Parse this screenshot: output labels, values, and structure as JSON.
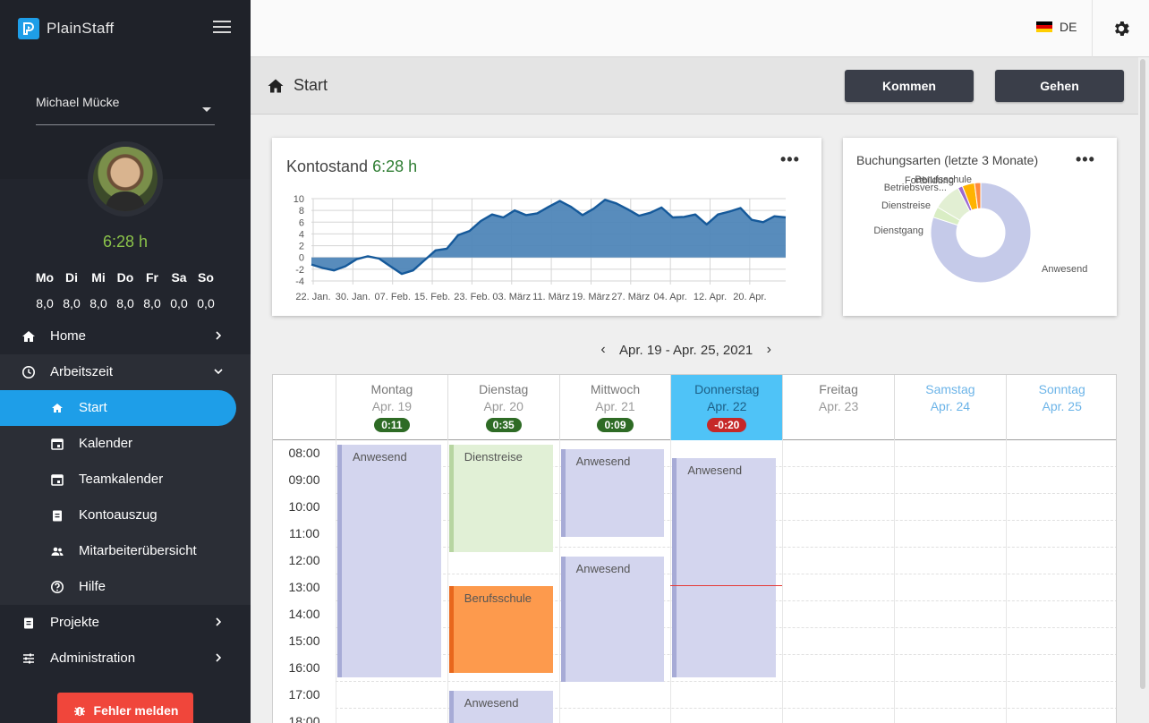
{
  "app": {
    "name": "PlainStaff"
  },
  "sidebar": {
    "user": "Michael Mücke",
    "balance": "6:28 h",
    "week": [
      {
        "day": "Mo",
        "hours": "8,0"
      },
      {
        "day": "Di",
        "hours": "8,0"
      },
      {
        "day": "Mi",
        "hours": "8,0"
      },
      {
        "day": "Do",
        "hours": "8,0"
      },
      {
        "day": "Fr",
        "hours": "8,0"
      },
      {
        "day": "Sa",
        "hours": "0,0"
      },
      {
        "day": "So",
        "hours": "0,0"
      }
    ],
    "nav": {
      "home": "Home",
      "arbeitszeit": "Arbeitszeit",
      "start": "Start",
      "kalender": "Kalender",
      "teamkalender": "Teamkalender",
      "kontoauszug": "Kontoauszug",
      "mitarbeiter": "Mitarbeiterübersicht",
      "hilfe": "Hilfe",
      "projekte": "Projekte",
      "administration": "Administration"
    },
    "bug_button": "Fehler melden"
  },
  "topbar": {
    "language": "DE"
  },
  "page": {
    "title": "Start",
    "btn_kommen": "Kommen",
    "btn_gehen": "Gehen"
  },
  "colors": {
    "accent": "#1e9ee8",
    "positive": "#2e7d32",
    "negative": "#c62828",
    "area": "#4f86b8",
    "line": "#15599a",
    "bug": "#f0463b"
  },
  "konto_card": {
    "title": "Kontostand",
    "value": "6:28 h",
    "more": "•••"
  },
  "buchung_card": {
    "title": "Buchungsarten (letzte 3 Monate)",
    "more": "•••"
  },
  "chart_data": [
    {
      "type": "area",
      "title": "Kontostand",
      "x_ticks": [
        "22. Jan.",
        "30. Jan.",
        "07. Feb.",
        "15. Feb.",
        "23. Feb.",
        "03. März",
        "11. März",
        "19. März",
        "27. März",
        "04. Apr.",
        "12. Apr.",
        "20. Apr."
      ],
      "y_ticks": [
        10,
        8,
        6,
        4,
        2,
        0,
        -2,
        -4
      ],
      "ylim": [
        -4,
        10
      ],
      "grid": true,
      "values": [
        -1.2,
        -1.8,
        -2.2,
        -1.5,
        -0.3,
        0.2,
        -0.2,
        -1.5,
        -2.8,
        -2.2,
        -0.5,
        1.2,
        1.5,
        3.8,
        4.5,
        6.2,
        7.3,
        6.8,
        8.0,
        7.2,
        7.5,
        8.6,
        9.6,
        8.6,
        7.2,
        8.3,
        9.8,
        9.2,
        8.2,
        7.1,
        7.6,
        8.5,
        6.8,
        6.9,
        7.3,
        5.6,
        7.3,
        7.8,
        8.4,
        6.4,
        6.0,
        7.0,
        6.8
      ]
    },
    {
      "type": "pie",
      "title": "Buchungsarten (letzte 3 Monate)",
      "categories": [
        "Anwesend",
        "Dienstgang",
        "Dienstreise",
        "Betriebsvers...",
        "Fortbildung",
        "Berufsschule"
      ],
      "values": [
        80,
        3.5,
        9,
        1.5,
        4,
        2
      ],
      "colors": [
        "#c5cae9",
        "#d9edc4",
        "#e2efd3",
        "#9c6bd1",
        "#ffb300",
        "#ff8a3d"
      ]
    }
  ],
  "calendar": {
    "range": "Apr. 19 - Apr. 25, 2021",
    "prev": "‹",
    "next": "›",
    "days": [
      {
        "name": "Montag",
        "date": "Apr. 19",
        "badge": "0:11"
      },
      {
        "name": "Dienstag",
        "date": "Apr. 20",
        "badge": "0:35"
      },
      {
        "name": "Mittwoch",
        "date": "Apr. 21",
        "badge": "0:09"
      },
      {
        "name": "Donnerstag",
        "date": "Apr. 22",
        "badge": "-0:20"
      },
      {
        "name": "Freitag",
        "date": "Apr. 23",
        "badge": ""
      },
      {
        "name": "Samstag",
        "date": "Apr. 24",
        "badge": ""
      },
      {
        "name": "Sonntag",
        "date": "Apr. 25",
        "badge": ""
      }
    ],
    "hours": [
      "08:00",
      "09:00",
      "10:00",
      "11:00",
      "12:00",
      "13:00",
      "14:00",
      "15:00",
      "16:00",
      "17:00",
      "18:00"
    ],
    "events": [
      {
        "day": 0,
        "label": "Anwesend",
        "start": "07:40",
        "end": "16:20"
      },
      {
        "day": 1,
        "label": "Dienstreise",
        "start": "07:40",
        "end": "11:40"
      },
      {
        "day": 1,
        "label": "Berufsschule",
        "start": "12:55",
        "end": "16:10"
      },
      {
        "day": 1,
        "label": "Anwesend",
        "start": "16:50",
        "end": "18:30"
      },
      {
        "day": 2,
        "label": "Anwesend",
        "start": "07:50",
        "end": "11:05"
      },
      {
        "day": 2,
        "label": "Anwesend",
        "start": "11:50",
        "end": "16:30"
      },
      {
        "day": 3,
        "label": "Anwesend",
        "start": "08:10",
        "end": "16:20"
      }
    ],
    "now": "12:53"
  }
}
